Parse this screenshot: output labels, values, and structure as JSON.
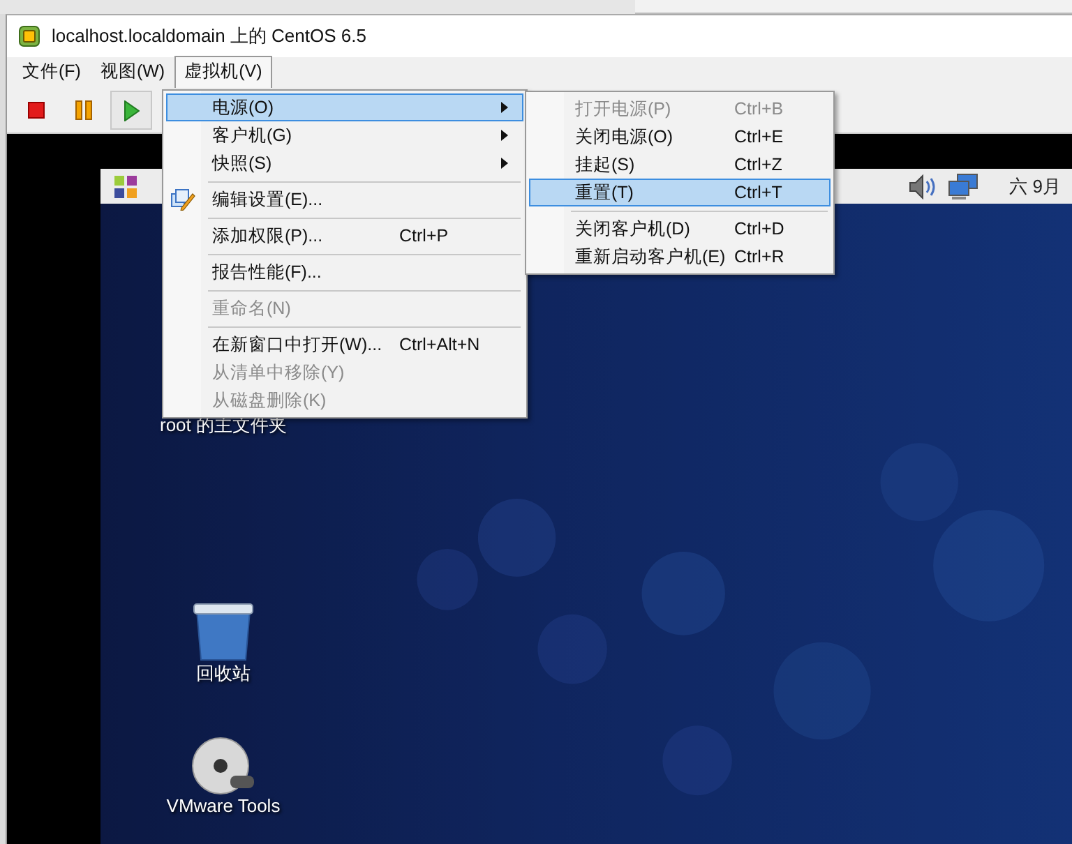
{
  "window": {
    "title": "localhost.localdomain 上的 CentOS 6.5"
  },
  "menubar": [
    {
      "label": "文件(F)",
      "selected": false
    },
    {
      "label": "视图(W)",
      "selected": false
    },
    {
      "label": "虚拟机(V)",
      "selected": true
    }
  ],
  "toolbar": [
    {
      "kind": "stop",
      "pressed": false
    },
    {
      "kind": "pause",
      "pressed": false
    },
    {
      "kind": "play",
      "pressed": true
    }
  ],
  "guest_panel": {
    "clock": "六 9月"
  },
  "desktop_icons": [
    {
      "kind": "home",
      "label": "root 的主文件夹"
    },
    {
      "kind": "trash",
      "label": "回收站"
    },
    {
      "kind": "dvd",
      "label": "VMware Tools"
    }
  ],
  "vm_menu": [
    {
      "kind": "item",
      "label": "电源(O)",
      "submenu": true,
      "selected": true,
      "disabled": false
    },
    {
      "kind": "item",
      "label": "客户机(G)",
      "submenu": true,
      "selected": false,
      "disabled": false
    },
    {
      "kind": "item",
      "label": "快照(S)",
      "submenu": true,
      "selected": false,
      "disabled": false
    },
    {
      "kind": "separator"
    },
    {
      "kind": "item",
      "label": "编辑设置(E)...",
      "icon": true,
      "selected": false,
      "disabled": false
    },
    {
      "kind": "separator"
    },
    {
      "kind": "item",
      "label": "添加权限(P)...",
      "shortcut": "Ctrl+P",
      "selected": false,
      "disabled": false
    },
    {
      "kind": "separator"
    },
    {
      "kind": "item",
      "label": "报告性能(F)...",
      "selected": false,
      "disabled": false
    },
    {
      "kind": "separator"
    },
    {
      "kind": "item",
      "label": "重命名(N)",
      "selected": false,
      "disabled": true
    },
    {
      "kind": "separator"
    },
    {
      "kind": "item",
      "label": "在新窗口中打开(W)...",
      "shortcut": "Ctrl+Alt+N",
      "selected": false,
      "disabled": false
    },
    {
      "kind": "item",
      "label": "从清单中移除(Y)",
      "selected": false,
      "disabled": true
    },
    {
      "kind": "item",
      "label": "从磁盘删除(K)",
      "selected": false,
      "disabled": true
    }
  ],
  "power_submenu": [
    {
      "kind": "item",
      "label": "打开电源(P)",
      "shortcut": "Ctrl+B",
      "selected": false,
      "disabled": true
    },
    {
      "kind": "item",
      "label": "关闭电源(O)",
      "shortcut": "Ctrl+E",
      "selected": false,
      "disabled": false
    },
    {
      "kind": "item",
      "label": "挂起(S)",
      "shortcut": "Ctrl+Z",
      "selected": false,
      "disabled": false
    },
    {
      "kind": "item",
      "label": "重置(T)",
      "shortcut": "Ctrl+T",
      "selected": true,
      "disabled": false
    },
    {
      "kind": "separator"
    },
    {
      "kind": "item",
      "label": "关闭客户机(D)",
      "shortcut": "Ctrl+D",
      "selected": false,
      "disabled": false
    },
    {
      "kind": "item",
      "label": "重新启动客户机(E)",
      "shortcut": "Ctrl+R",
      "selected": false,
      "disabled": false
    }
  ]
}
